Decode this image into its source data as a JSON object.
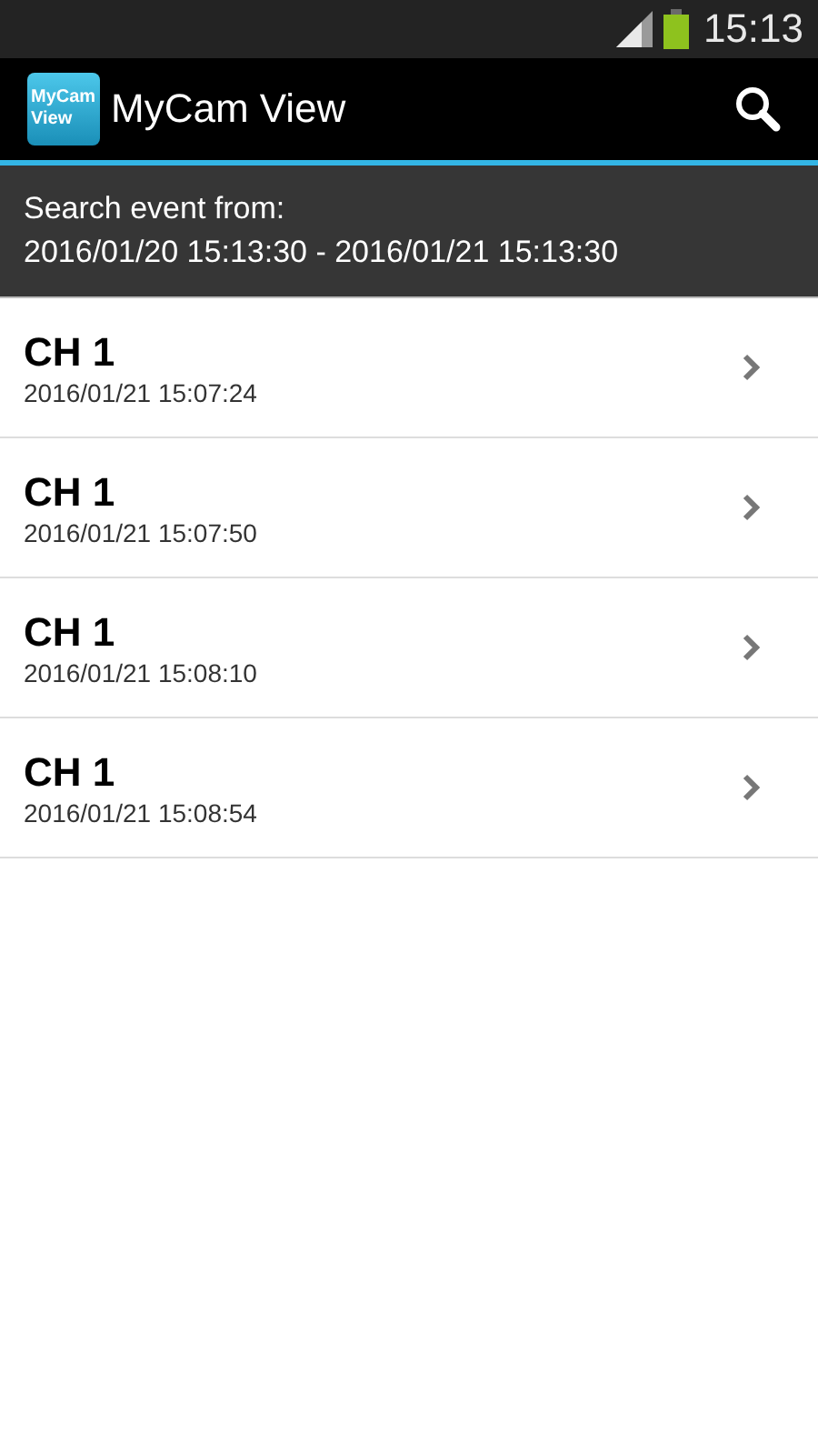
{
  "status_bar": {
    "time": "15:13"
  },
  "app_bar": {
    "logo_lines": [
      "MyCam",
      "View"
    ],
    "title": "MyCam View"
  },
  "search_range": {
    "label": "Search event from:",
    "range": "2016/01/20 15:13:30 - 2016/01/21 15:13:30"
  },
  "events": [
    {
      "channel": "CH 1",
      "time": "2016/01/21 15:07:24"
    },
    {
      "channel": "CH 1",
      "time": "2016/01/21 15:07:50"
    },
    {
      "channel": "CH 1",
      "time": "2016/01/21 15:08:10"
    },
    {
      "channel": "CH 1",
      "time": "2016/01/21 15:08:54"
    }
  ]
}
